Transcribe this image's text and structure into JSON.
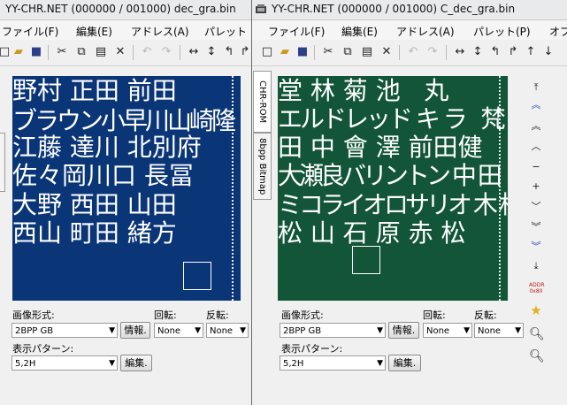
{
  "left_window": {
    "title": "YY-CHR.NET (000000 / 001000) dec_gra.bin",
    "menu": [
      "ファイル(F)",
      "編集(E)",
      "アドレス(A)",
      "パレット"
    ],
    "canvas_rows": [
      "野村 正田 前田",
      "ブラウン小早川山崎隆",
      "江藤 達川 北別府",
      "佐々岡川口 長冨",
      "大野 西田 山田",
      "西山 町田 緒方"
    ],
    "labels": {
      "format": "画像形式:",
      "rotate": "回転:",
      "flip": "反転:",
      "pattern": "表示パターン:"
    },
    "format_value": "2BPP GB",
    "info_button": "情報.",
    "rotate_value": "None",
    "flip_value": "None",
    "pattern_value": "5,2H",
    "edit_button": "編集."
  },
  "right_window": {
    "title": "YY-CHR.NET (000000 / 001000) C_dec_gra.bin",
    "menu": [
      "ファイル(F)",
      "編集(E)",
      "アドレス(A)",
      "パレット(P)",
      "オプ"
    ],
    "tabs": [
      "CHR-ROM",
      "8bpp Bitmap"
    ],
    "canvas_rows": [
      "堂 林 菊 池   丸",
      "エルドレッド キ ラ   梵",
      "田 中 會 澤 前田健",
      "大瀬良バリントン 中 田",
      "ミコライオロサリオ 木 村",
      "松 山 石 原 赤 松"
    ],
    "labels": {
      "format": "画像形式:",
      "rotate": "回転:",
      "flip": "反転:",
      "pattern": "表示パターン:"
    },
    "format_value": "2BPP GB",
    "info_button": "情報.",
    "rotate_value": "None",
    "flip_value": "None",
    "pattern_value": "5,2H",
    "edit_button": "編集.",
    "side_tools": {
      "addr": "ADDR",
      "addr_value": "0x80"
    }
  },
  "colors": {
    "left_bg": "#0a3577",
    "right_bg": "#125538",
    "glyph": "#ffffff"
  }
}
